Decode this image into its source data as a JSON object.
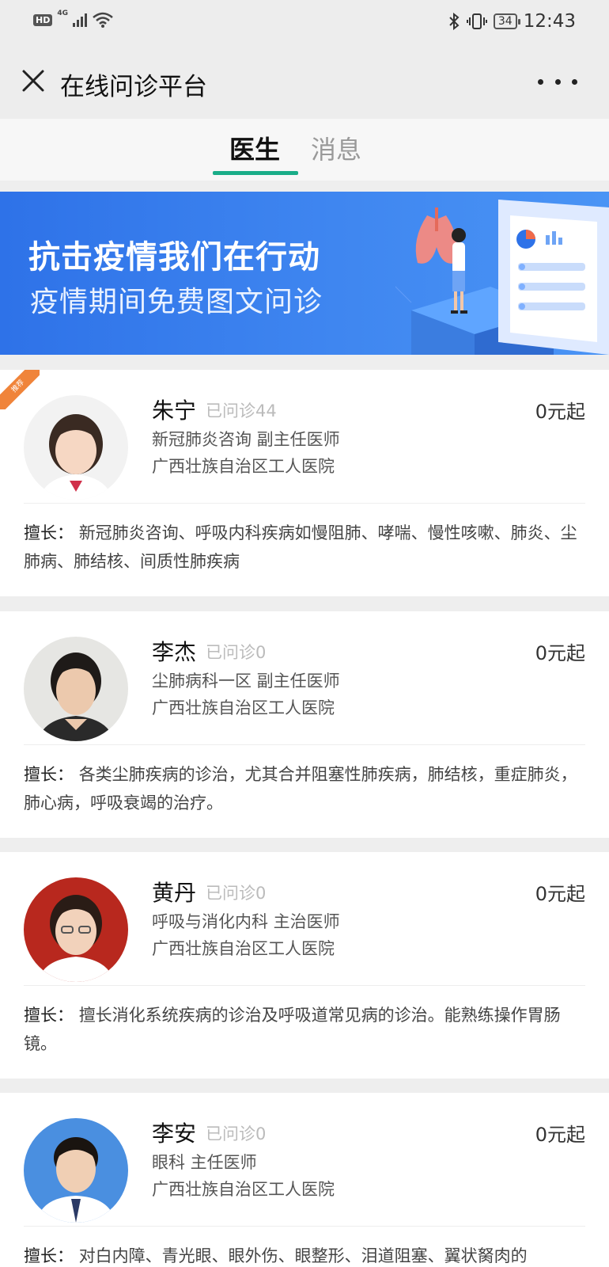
{
  "status_bar": {
    "hd": "HD",
    "network": "4G",
    "battery": "34",
    "time": "12:43"
  },
  "title_bar": {
    "title": "在线问诊平台"
  },
  "tabs": [
    {
      "label": "医生",
      "active": true
    },
    {
      "label": "消息",
      "active": false
    }
  ],
  "banner": {
    "title": "抗击疫情我们在行动",
    "subtitle": "疫情期间免费图文问诊"
  },
  "doctors": [
    {
      "name": "朱宁",
      "consults": "已问诊44",
      "price": "0元起",
      "dept": "新冠肺炎咨询 副主任医师",
      "hospital": "广西壮族自治区工人医院",
      "spec_key": "擅长：",
      "spec": "新冠肺炎咨询、呼吸内科疾病如慢阻肺、哮喘、慢性咳嗽、肺炎、尘肺病、肺结核、间质性肺疾病",
      "badge": "推荐"
    },
    {
      "name": "李杰",
      "consults": "已问诊0",
      "price": "0元起",
      "dept": "尘肺病科一区 副主任医师",
      "hospital": "广西壮族自治区工人医院",
      "spec_key": "擅长：",
      "spec": "各类尘肺疾病的诊治，尤其合并阻塞性肺疾病，肺结核，重症肺炎，肺心病，呼吸衰竭的治疗。"
    },
    {
      "name": "黄丹",
      "consults": "已问诊0",
      "price": "0元起",
      "dept": "呼吸与消化内科 主治医师",
      "hospital": "广西壮族自治区工人医院",
      "spec_key": "擅长：",
      "spec": "擅长消化系统疾病的诊治及呼吸道常见病的诊治。能熟练操作胃肠镜。"
    },
    {
      "name": "李安",
      "consults": "已问诊0",
      "price": "0元起",
      "dept": "眼科 主任医师",
      "hospital": "广西壮族自治区工人医院",
      "spec_key": "擅长：",
      "spec": "对白内障、青光眼、眼外伤、眼整形、泪道阻塞、翼状胬肉的"
    }
  ]
}
